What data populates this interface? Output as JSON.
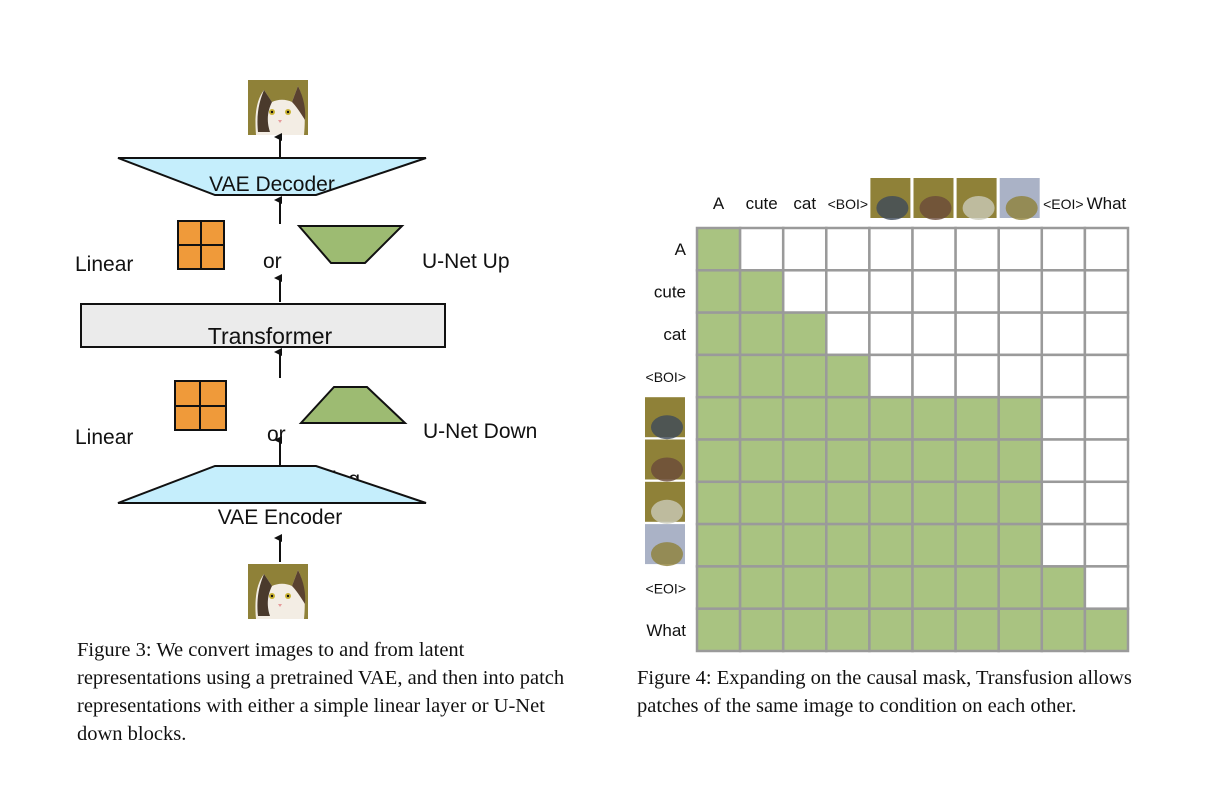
{
  "figure3": {
    "labels": {
      "vae_decoder": "VAE Decoder",
      "linear_top": "Linear",
      "or_top": "or",
      "unet_up": "U-Net Up",
      "transformer": "Transformer",
      "linear_bottom": "Linear",
      "or_bottom": "or",
      "unet_down": "U-Net Down",
      "noising": "Noising",
      "vae_encoder": "VAE Encoder"
    },
    "colors": {
      "vae": "#c5eefc",
      "linear": "#ef9a3a",
      "unet": "#9dbb72",
      "transformer": "#ebebeb"
    },
    "caption": "Figure 3: We convert images to and from latent representations using a pretrained VAE, and then into patch representations with either a simple linear layer or U-Net down blocks."
  },
  "figure4": {
    "tokens": [
      "A",
      "cute",
      "cat",
      "<BOI>",
      "[image patch 1]",
      "[image patch 2]",
      "[image patch 3]",
      "[image patch 4]",
      "<EOI>",
      "What"
    ],
    "token_is_image": [
      false,
      false,
      false,
      false,
      true,
      true,
      true,
      true,
      false,
      false
    ],
    "mask": [
      [
        1,
        0,
        0,
        0,
        0,
        0,
        0,
        0,
        0,
        0
      ],
      [
        1,
        1,
        0,
        0,
        0,
        0,
        0,
        0,
        0,
        0
      ],
      [
        1,
        1,
        1,
        0,
        0,
        0,
        0,
        0,
        0,
        0
      ],
      [
        1,
        1,
        1,
        1,
        0,
        0,
        0,
        0,
        0,
        0
      ],
      [
        1,
        1,
        1,
        1,
        1,
        1,
        1,
        1,
        0,
        0
      ],
      [
        1,
        1,
        1,
        1,
        1,
        1,
        1,
        1,
        0,
        0
      ],
      [
        1,
        1,
        1,
        1,
        1,
        1,
        1,
        1,
        0,
        0
      ],
      [
        1,
        1,
        1,
        1,
        1,
        1,
        1,
        1,
        0,
        0
      ],
      [
        1,
        1,
        1,
        1,
        1,
        1,
        1,
        1,
        1,
        0
      ],
      [
        1,
        1,
        1,
        1,
        1,
        1,
        1,
        1,
        1,
        1
      ]
    ],
    "colors": {
      "attend": "#a9c381",
      "blocked": "#ffffff",
      "grid": "#9a9a9a"
    },
    "caption": "Figure 4: Expanding on the causal mask, Transfusion allows patches of the same image to condition on each other."
  }
}
